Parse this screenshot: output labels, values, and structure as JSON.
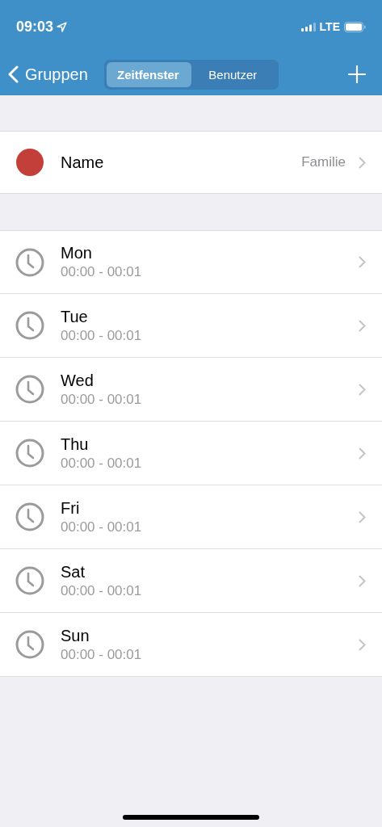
{
  "status_bar": {
    "time": "09:03",
    "network": "LTE"
  },
  "nav_bar": {
    "back": "Gruppen",
    "tabs": [
      {
        "label": "Zeitfenster",
        "selected": true
      },
      {
        "label": "Benutzer",
        "selected": false
      }
    ]
  },
  "group": {
    "label": "Name",
    "value": "Familie",
    "color": "#c3403a"
  },
  "time_windows": [
    {
      "day": "Mon",
      "range": "00:00 - 00:01"
    },
    {
      "day": "Tue",
      "range": "00:00 - 00:01"
    },
    {
      "day": "Wed",
      "range": "00:00 - 00:01"
    },
    {
      "day": "Thu",
      "range": "00:00 - 00:01"
    },
    {
      "day": "Fri",
      "range": "00:00 - 00:01"
    },
    {
      "day": "Sat",
      "range": "00:00 - 00:01"
    },
    {
      "day": "Sun",
      "range": "00:00 - 00:01"
    }
  ]
}
